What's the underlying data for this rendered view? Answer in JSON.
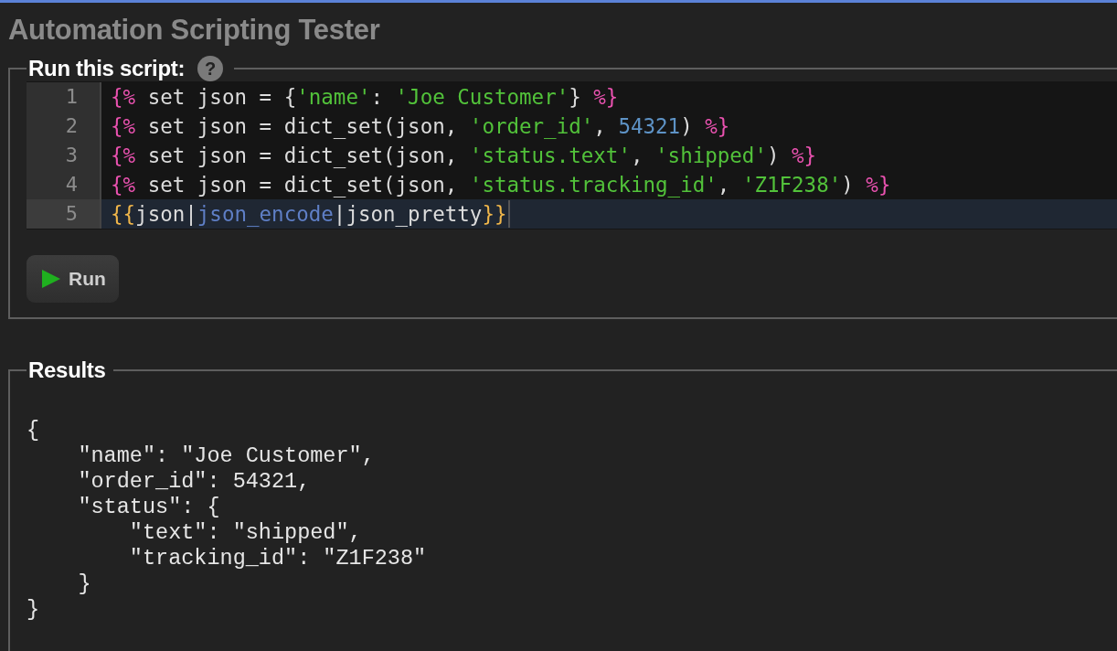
{
  "title": "Automation Scripting Tester",
  "script": {
    "legend": "Run this script:",
    "help": "?",
    "lines": [
      {
        "number": "1",
        "active": false,
        "tokens": [
          {
            "kind": "tag",
            "text": "{%"
          },
          {
            "kind": "plain",
            "text": " set json = {"
          },
          {
            "kind": "string",
            "text": "'name'"
          },
          {
            "kind": "plain",
            "text": ": "
          },
          {
            "kind": "string",
            "text": "'Joe Customer'"
          },
          {
            "kind": "plain",
            "text": "} "
          },
          {
            "kind": "tag",
            "text": "%}"
          }
        ]
      },
      {
        "number": "2",
        "active": false,
        "tokens": [
          {
            "kind": "tag",
            "text": "{%"
          },
          {
            "kind": "plain",
            "text": " set json = dict_set(json, "
          },
          {
            "kind": "string",
            "text": "'order_id'"
          },
          {
            "kind": "plain",
            "text": ", "
          },
          {
            "kind": "number",
            "text": "54321"
          },
          {
            "kind": "plain",
            "text": ") "
          },
          {
            "kind": "tag",
            "text": "%}"
          }
        ]
      },
      {
        "number": "3",
        "active": false,
        "tokens": [
          {
            "kind": "tag",
            "text": "{%"
          },
          {
            "kind": "plain",
            "text": " set json = dict_set(json, "
          },
          {
            "kind": "string",
            "text": "'status.text'"
          },
          {
            "kind": "plain",
            "text": ", "
          },
          {
            "kind": "string",
            "text": "'shipped'"
          },
          {
            "kind": "plain",
            "text": ") "
          },
          {
            "kind": "tag",
            "text": "%}"
          }
        ]
      },
      {
        "number": "4",
        "active": false,
        "tokens": [
          {
            "kind": "tag",
            "text": "{%"
          },
          {
            "kind": "plain",
            "text": " set json = dict_set(json, "
          },
          {
            "kind": "string",
            "text": "'status.tracking_id'"
          },
          {
            "kind": "plain",
            "text": ", "
          },
          {
            "kind": "string",
            "text": "'Z1F238'"
          },
          {
            "kind": "plain",
            "text": ") "
          },
          {
            "kind": "tag",
            "text": "%}"
          }
        ]
      },
      {
        "number": "5",
        "active": true,
        "tokens": [
          {
            "kind": "output",
            "text": "{{"
          },
          {
            "kind": "plain",
            "text": "json|"
          },
          {
            "kind": "filter",
            "text": "json_encode"
          },
          {
            "kind": "plain",
            "text": "|json_pretty"
          },
          {
            "kind": "output",
            "text": "}}"
          }
        ]
      }
    ]
  },
  "run_button": {
    "label": "Run"
  },
  "results": {
    "legend": "Results",
    "lines": [
      "{",
      "    \"name\": \"Joe Customer\",",
      "    \"order_id\": 54321,",
      "    \"status\": {",
      "        \"text\": \"shipped\",",
      "        \"tracking_id\": \"Z1F238\"",
      "    }",
      "}"
    ]
  }
}
